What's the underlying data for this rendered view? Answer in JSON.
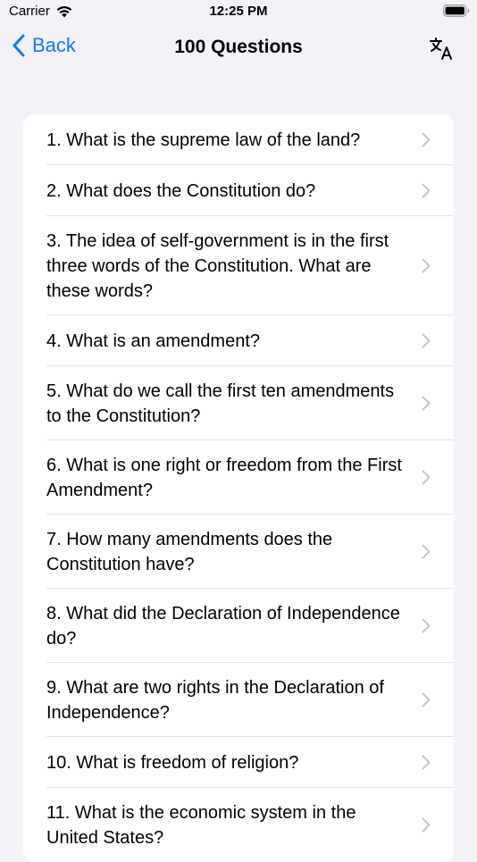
{
  "status_bar": {
    "carrier": "Carrier",
    "time": "12:25 PM"
  },
  "nav": {
    "back_label": "Back",
    "title": "100 Questions",
    "translate_icon": "translate-icon"
  },
  "colors": {
    "accent": "#0a7aff",
    "background": "#f2f2f7",
    "chevron": "#c4c4c7"
  },
  "questions": [
    "1. What is the supreme law of the land?",
    "2. What does the Constitution do?",
    "3. The idea of self-government is in the first three words of the Constitution. What are these words?",
    "4. What is an amendment?",
    "5. What do we call the first ten amendments to the Constitution?",
    "6. What is one right or freedom from the First Amendment?",
    "7. How many amendments does the Constitution have?",
    "8. What did the Declaration of Independence do?",
    "9. What are two rights in the Declaration of Independence?",
    "10. What is freedom of religion?",
    "11. What is the economic system in the United States?"
  ]
}
